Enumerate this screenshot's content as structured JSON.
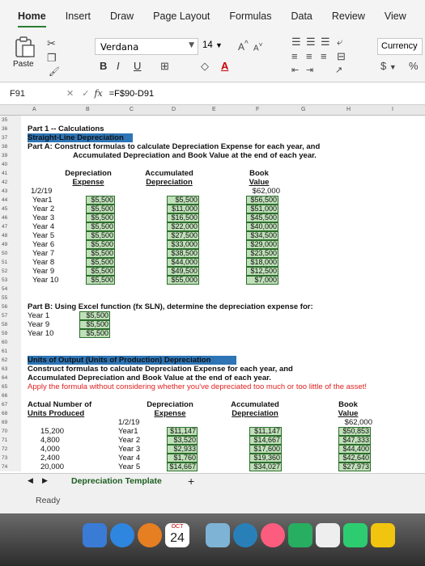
{
  "ribbon": {
    "tabs": [
      "Home",
      "Insert",
      "Draw",
      "Page Layout",
      "Formulas",
      "Data",
      "Review",
      "View"
    ],
    "paste_label": "Paste",
    "font_name": "Verdana",
    "font_size": "14",
    "number_format": "Currency",
    "font_grow": "A",
    "font_shrink": "A",
    "bold": "B",
    "italic": "I",
    "underline": "U",
    "dollar": "$",
    "percent": "%"
  },
  "formula_bar": {
    "name_box": "F91",
    "fx": "fx",
    "formula": "=F$90-D91"
  },
  "columns": [
    "A",
    "B",
    "C",
    "D",
    "E",
    "F",
    "G",
    "H",
    "I"
  ],
  "rows_visible": [
    "35",
    "36",
    "37",
    "38",
    "39",
    "40",
    "41",
    "42",
    "43",
    "44",
    "45",
    "46",
    "47",
    "48",
    "49",
    "50",
    "51",
    "52",
    "53",
    "54",
    "55",
    "56",
    "57",
    "58",
    "59",
    "60",
    "61",
    "62",
    "63",
    "64",
    "65",
    "66",
    "67",
    "68",
    "69",
    "70",
    "71",
    "72",
    "73",
    "74"
  ],
  "part1": {
    "title": "Part 1 -- Calculations",
    "subtitle": "Straight-Line Depreciation",
    "instruction_line1": "Part A: Construct formulas to calculate Depreciation Expense for each year, and",
    "instruction_line2": "Accumulated Depreciation and Book Value at the end of each year."
  },
  "table1": {
    "headers": {
      "dep1": "Depreciation",
      "dep2": "Expense",
      "acc1": "Accumulated",
      "acc2": "Depreciation",
      "book1": "Book",
      "book2": "Value"
    },
    "start_label": "1/2/19",
    "start_value": "$62,000",
    "rows": [
      {
        "year": "Year1",
        "exp": "$5,500",
        "acc": "$5,500",
        "book": "$56,500"
      },
      {
        "year": "Year 2",
        "exp": "$5,500",
        "acc": "$11,000",
        "book": "$51,000"
      },
      {
        "year": "Year 3",
        "exp": "$5,500",
        "acc": "$16,500",
        "book": "$45,500"
      },
      {
        "year": "Year 4",
        "exp": "$5,500",
        "acc": "$22,000",
        "book": "$40,000"
      },
      {
        "year": "Year 5",
        "exp": "$5,500",
        "acc": "$27,500",
        "book": "$34,500"
      },
      {
        "year": "Year 6",
        "exp": "$5,500",
        "acc": "$33,000",
        "book": "$29,000"
      },
      {
        "year": "Year 7",
        "exp": "$5,500",
        "acc": "$38,500",
        "book": "$23,500"
      },
      {
        "year": "Year 8",
        "exp": "$5,500",
        "acc": "$44,000",
        "book": "$18,000"
      },
      {
        "year": "Year 9",
        "exp": "$5,500",
        "acc": "$49,500",
        "book": "$12,500"
      },
      {
        "year": "Year 10",
        "exp": "$5,500",
        "acc": "$55,000",
        "book": "$7,000"
      }
    ]
  },
  "partB": {
    "instruction": "Part B: Using Excel function (fx SLN), determine the depreciation expense for:",
    "rows": [
      {
        "label": "Year 1",
        "value": "$5,500"
      },
      {
        "label": "Year 9",
        "value": "$5,500"
      },
      {
        "label": "Year 10",
        "value": "$5,500"
      }
    ]
  },
  "units": {
    "title": "Units of Output (Units of Production) Depreciation",
    "line1": "Construct formulas to calculate Depreciation Expense for each year, and",
    "line2": "Accumulated Depreciation and Book Value at the end of each year.",
    "warning": "Apply the formula without considering whether you've depreciated too much or too little of the asset!"
  },
  "table2": {
    "headers": {
      "actual1": "Actual Number of",
      "actual2": "Units Produced",
      "dep1": "Depreciation",
      "dep2": "Expense",
      "acc1": "Accumulated",
      "acc2": "Depreciation",
      "book1": "Book",
      "book2": "Value"
    },
    "start_label": "1/2/19",
    "start_value": "$62,000",
    "rows": [
      {
        "units": "15,200",
        "year": "Year1",
        "exp": "$11,147",
        "acc": "$11,147",
        "book": "$50,853"
      },
      {
        "units": "4,800",
        "year": "Year 2",
        "exp": "$3,520",
        "acc": "$14,667",
        "book": "$47,333"
      },
      {
        "units": "4,000",
        "year": "Year 3",
        "exp": "$2,933",
        "acc": "$17,600",
        "book": "$44,400"
      },
      {
        "units": "2,400",
        "year": "Year 4",
        "exp": "$1,760",
        "acc": "$19,360",
        "book": "$42,640"
      },
      {
        "units": "20,000",
        "year": "Year 5",
        "exp": "$14,667",
        "acc": "$34,027",
        "book": "$27,973"
      }
    ]
  },
  "sheet_tab": "Depreciation Template",
  "add_sheet": "+",
  "status": "Ready",
  "dock": {
    "calendar_month": "OCT",
    "calendar_day": "24"
  }
}
